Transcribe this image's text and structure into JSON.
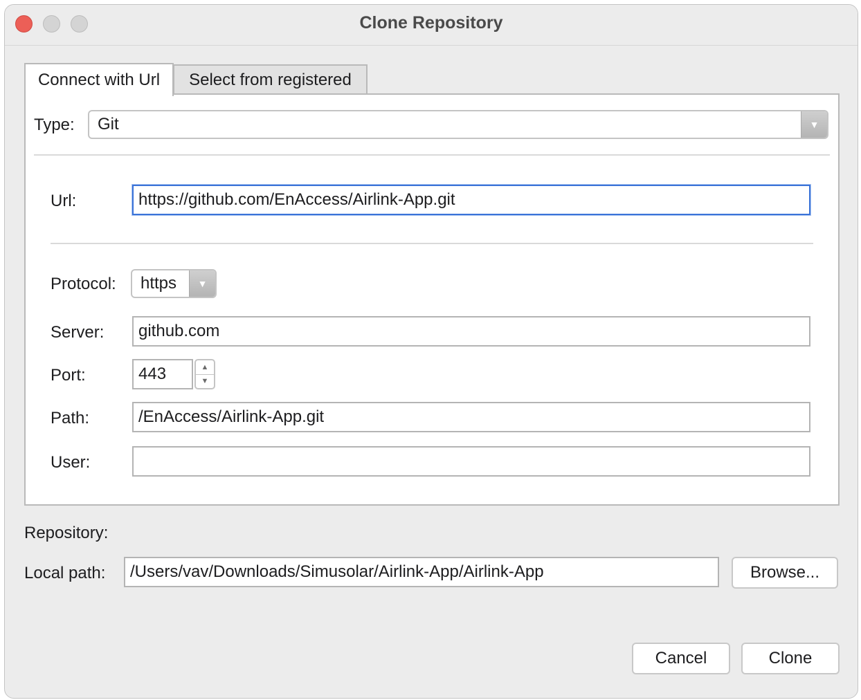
{
  "window": {
    "title": "Clone Repository"
  },
  "tabs": [
    {
      "label": "Connect with Url",
      "active": true
    },
    {
      "label": "Select from registered",
      "active": false
    }
  ],
  "form": {
    "type_label": "Type:",
    "type_value": "Git",
    "url_label": "Url:",
    "url_value": "https://github.com/EnAccess/Airlink-App.git",
    "protocol_label": "Protocol:",
    "protocol_value": "https",
    "server_label": "Server:",
    "server_value": "github.com",
    "port_label": "Port:",
    "port_value": "443",
    "path_label": "Path:",
    "path_value": "/EnAccess/Airlink-App.git",
    "user_label": "User:",
    "user_value": ""
  },
  "repository": {
    "section_label": "Repository:",
    "local_path_label": "Local path:",
    "local_path_value": "/Users/vav/Downloads/Simusolar/Airlink-App/Airlink-App",
    "browse_label": "Browse..."
  },
  "buttons": {
    "cancel_label": "Cancel",
    "clone_label": "Clone"
  },
  "icons": {
    "dropdown": "chevron-down-icon",
    "spin_up": "arrow-up-icon",
    "spin_down": "arrow-down-icon"
  },
  "colors": {
    "focus_border": "#3b73d8",
    "close_button": "#ec5f57"
  }
}
